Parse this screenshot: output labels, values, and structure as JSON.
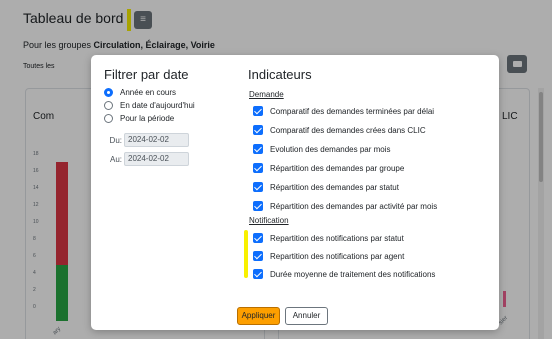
{
  "page": {
    "title": "Tableau de bord",
    "subtitle_prefix": "Pour les groupes ",
    "subtitle_groups": "Circulation, Éclairage, Voirie",
    "filter_label": "Toutes les",
    "card_left_title": "Com",
    "card_right_title": "LIC",
    "y_ticks": [
      "18",
      "16",
      "14",
      "12",
      "10",
      "8",
      "6",
      "4",
      "2",
      "0"
    ],
    "rot_label_right": "sier",
    "rot_label_left": "ary"
  },
  "modal": {
    "date_filter": {
      "title": "Filtrer par date",
      "options": [
        {
          "label": "Année en cours",
          "selected": true
        },
        {
          "label": "En date d'aujourd'hui",
          "selected": false
        },
        {
          "label": "Pour la période",
          "selected": false
        }
      ],
      "from_label": "Du:",
      "from_value": "2024-02-02",
      "to_label": "Au:",
      "to_value": "2024-02-02"
    },
    "indicators": {
      "title": "Indicateurs",
      "groups": [
        {
          "title": "Demande",
          "items": [
            {
              "label": "Comparatif des demandes terminées par délai",
              "checked": true
            },
            {
              "label": "Comparatif des demandes crées dans CLIC",
              "checked": true
            },
            {
              "label": "Evolution des demandes par mois",
              "checked": true
            },
            {
              "label": "Répartition des demandes par groupe",
              "checked": true
            },
            {
              "label": "Répartition des demandes par statut",
              "checked": true
            },
            {
              "label": "Répartition des demandes par activité par mois",
              "checked": true
            }
          ]
        },
        {
          "title": "Notification",
          "items": [
            {
              "label": "Repartition des notifications par statut",
              "checked": true
            },
            {
              "label": "Repartition des notifications par agent",
              "checked": true
            },
            {
              "label": "Durée moyenne de traitement des notifications",
              "checked": true
            }
          ]
        }
      ]
    },
    "apply_label": "Appliquer",
    "cancel_label": "Annuler"
  },
  "colors": {
    "primary": "#0d6efd",
    "apply": "#fd9f00",
    "highlight": "#f8f000",
    "bar_red": "#dc3545",
    "bar_green": "#28a745"
  }
}
